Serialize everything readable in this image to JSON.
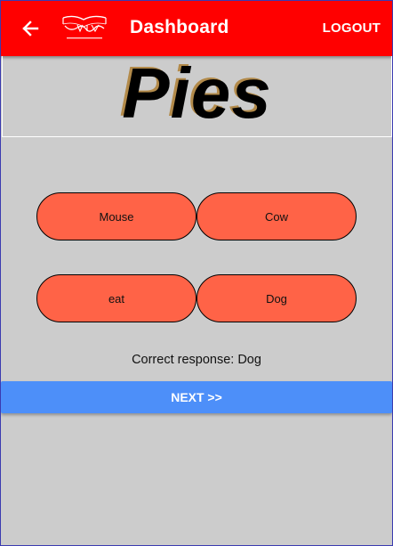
{
  "appbar": {
    "title": "Dashboard",
    "logout_label": "LOGOUT",
    "back_icon": "arrow-left-icon",
    "logo": "app-logo",
    "color": "#ff0000"
  },
  "question": {
    "word": "Pies"
  },
  "options": [
    {
      "label": "Mouse"
    },
    {
      "label": "Cow"
    },
    {
      "label": "eat"
    },
    {
      "label": "Dog"
    }
  ],
  "option_color": "#ff6347",
  "result": {
    "text": "Correct response: Dog"
  },
  "next": {
    "label": "NEXT >>",
    "color": "#4d8ff9"
  }
}
